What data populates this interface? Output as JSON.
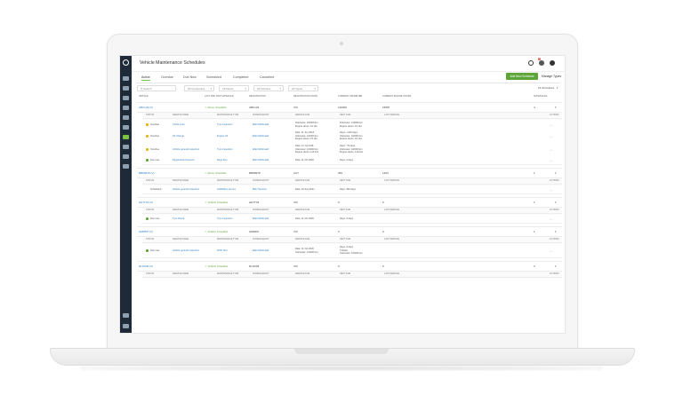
{
  "app": {
    "title": "Vehicle Maintenance Schedules",
    "notification_count": "9",
    "colors": {
      "accent": "#7cc242",
      "primary_button": "#5ea539",
      "link": "#2f7fc1",
      "sidebar": "#1f2a38",
      "overdue": "#e8b400",
      "due_now": "#5ea539"
    }
  },
  "tabs": [
    "Active",
    "Overdue",
    "Due Now",
    "Scheduled",
    "Completed",
    "Cancelled"
  ],
  "buttons": {
    "add": "Add New Schedule",
    "manage": "Manage Types"
  },
  "filters": {
    "search_placeholder": "Search",
    "company": "All Companies",
    "fleets": "All Fleets",
    "vehicles": "All Vehicles",
    "types": "All Types",
    "schedules_count": "16 Schedules"
  },
  "columns": [
    "VEHICLE",
    "LAST PRE TRIP SCHEDULE",
    "REGISTRATION",
    "REGISTRATION STATE",
    "CURRENT ODOMETER",
    "CURRENT ENGINE HOURS",
    "SCHEDULES"
  ],
  "sub_columns": [
    "STATUS",
    "SERVICE NAME",
    "MAINTENANCE TYPE",
    "SCHEDULED BY",
    "SERVICE DUE",
    "NEXT DUE",
    "LAST SERVICE",
    "ACTIONS"
  ],
  "groups": [
    {
      "vehicle": "ABC123 (V)",
      "pretrip": "Driver Checklist",
      "rego": "ABC123",
      "state": "VIC",
      "odo": "120000",
      "hours": "15687",
      "count": "4",
      "rows": [
        {
          "status": "Overdue",
          "service": "Check tyres",
          "type": "Tyre inspection",
          "by": "Elliot McDonald",
          "due": "Odometer: 110000 km",
          "due2": "Engine Hours: 10 Hrs",
          "next": "Odometer: 120000 km",
          "next2": "Engine Hours: 10 Hrs",
          "last": ""
        },
        {
          "status": "Overdue",
          "service": "Oil Change",
          "type": "Engine Oil",
          "by": "Elliot McDonald",
          "due": "Date: 11 Jun 2018",
          "due2": "Odometer: 110000 km",
          "due3": "Engine Hours: 15 Hrs",
          "next": "Days: -1126 days",
          "next2": "Odometer: 110000 km",
          "next3": "Engine Hours: 15 Hrs",
          "last": ""
        },
        {
          "status": "Overdue",
          "service": "Vehicle general inspection",
          "type": "Tyre inspection",
          "by": "Elliot McDonald",
          "due": "Date: 21 Jul 2018",
          "due2": "Odometer: 120000 km",
          "due3": "Engine Hours: 110 Hrs",
          "next": "Days: -79 days",
          "next2": "Odometer: 110000 km",
          "next3": "Engine Hours: 110 Hrs",
          "last": ""
        },
        {
          "status": "Due now",
          "service": "Registration Payment",
          "type": "Rego Due",
          "by": "Elliot McDonald",
          "due": "Date: 11 Oct 2020",
          "next": "Days: 0 days",
          "last": ""
        }
      ]
    },
    {
      "vehicle": "BBS8978 (V)",
      "pretrip": "Driver Checklist",
      "rego": "BBS8978",
      "state": "ACT",
      "odo": "350",
      "hours": "1463",
      "count": "1",
      "rows": [
        {
          "status": "Scheduled",
          "service": "Vehicle general inspection",
          "type": "100000km service",
          "by": "Billy Thornton",
          "due": "Date: 16 Sep 2021",
          "next": "Days: 336 days",
          "last": ""
        }
      ]
    },
    {
      "vehicle": "HH7T23 (V)",
      "pretrip": "Vehicle Checklist",
      "rego": "HH7T23",
      "state": "VIC",
      "odo": "0",
      "hours": "0",
      "count": "1",
      "rows": [
        {
          "status": "Due now",
          "service": "Tyre Check",
          "type": "Tyre inspection",
          "by": "Elliot McDonald",
          "due": "Date: 11 Oct 2020",
          "next": "Days: 0 days",
          "last": ""
        }
      ]
    },
    {
      "vehicle": "HM0807 (V)",
      "pretrip": "Vehicle Checklist",
      "rego": "HM0807",
      "state": "VIC",
      "odo": "0",
      "hours": "0",
      "count": "1",
      "rows": [
        {
          "status": "Due now",
          "service": "Vehicle general inspection",
          "type": "WOF Test",
          "by": "Elliot McDonald",
          "due": "Date: 11 Oct 2020",
          "due2": "Odometer: 120000 km",
          "next": "Days: 0 days",
          "next2": "6 Week",
          "next3": "Odometer: 120000 km",
          "last": ""
        }
      ]
    },
    {
      "vehicle": "RLG609 (V)",
      "pretrip": "Vehicle Checklist",
      "rego": "RLG609",
      "state": "VIC",
      "odo": "0",
      "hours": "0",
      "count": "2",
      "rows": []
    }
  ]
}
